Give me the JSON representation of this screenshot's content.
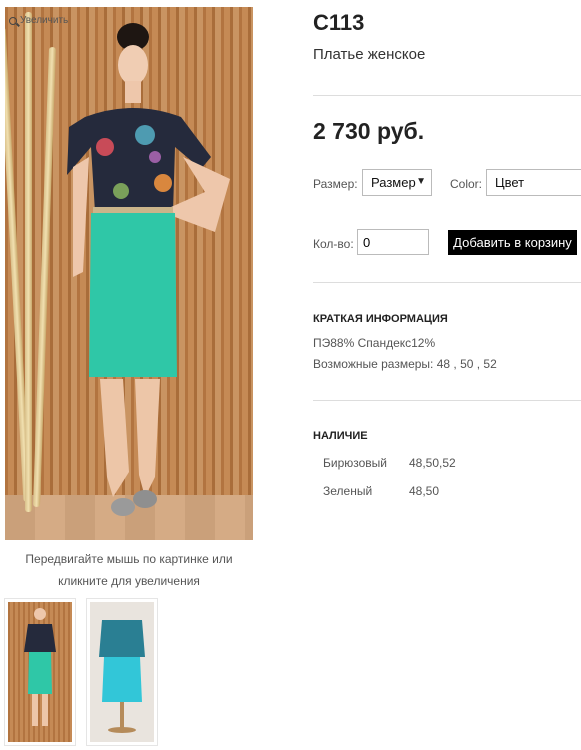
{
  "gallery": {
    "zoom_label": "Увеличить",
    "hint": "Передвигайте мышь по картинке или кликните для увеличения"
  },
  "product": {
    "code": "С113",
    "name": "Платье женское",
    "price": "2 730 руб."
  },
  "options": {
    "size_label": "Размер:",
    "size_value": "Размер",
    "color_label": "Color:",
    "color_value": "Цвет",
    "qty_label": "Кол-во:",
    "qty_value": "0",
    "add_to_cart": "Добавить в корзину"
  },
  "brief": {
    "title": "КРАТКАЯ ИНФОРМАЦИЯ",
    "composition": "ПЭ88% Спандекс12%",
    "sizes": "Возможные размеры: 48 , 50 , 52"
  },
  "availability": {
    "title": "НАЛИЧИЕ",
    "rows": [
      {
        "color": "Бирюзовый",
        "sizes": "48,50,52"
      },
      {
        "color": "Зеленый",
        "sizes": "48,50"
      }
    ]
  }
}
